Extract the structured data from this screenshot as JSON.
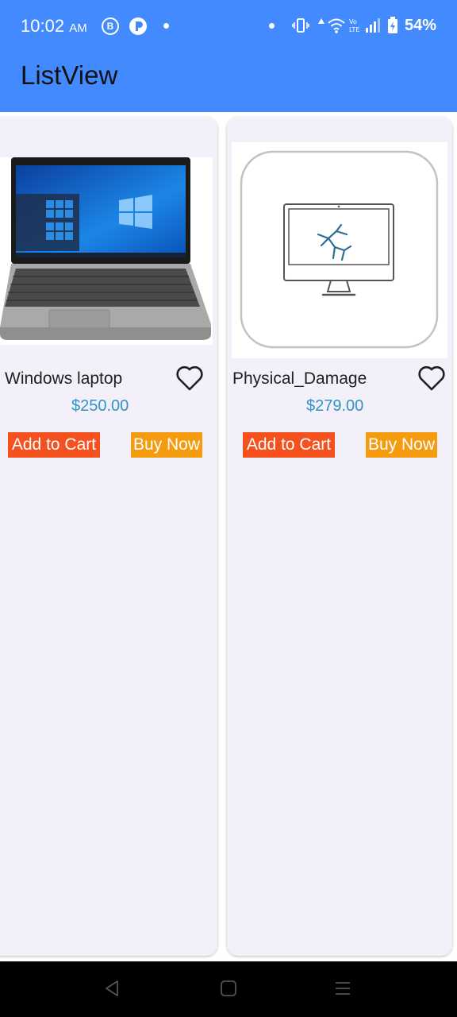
{
  "status_bar": {
    "time": "10:02",
    "ampm": "AM",
    "badge_b": "B",
    "battery": "54%"
  },
  "app_bar": {
    "title": "ListView"
  },
  "products": [
    {
      "name": "Windows laptop",
      "price": "$250.00",
      "add_to_cart_label": "Add to Cart",
      "buy_now_label": "Buy Now",
      "image_icon": "laptop-image",
      "favorite_icon": "heart-outline-icon"
    },
    {
      "name": "Physical_Damage",
      "price": "$279.00",
      "add_to_cart_label": "Add to Cart",
      "buy_now_label": "Buy Now",
      "image_icon": "cracked-monitor-image",
      "favorite_icon": "heart-outline-icon"
    }
  ],
  "colors": {
    "app_bar": "#448aff",
    "card_bg": "#f4f0fa",
    "price": "#2e94c8",
    "add_to_cart": "#f4511e",
    "buy_now": "#f59b10"
  },
  "nav_icons": [
    "back-icon",
    "home-icon",
    "recents-icon"
  ]
}
